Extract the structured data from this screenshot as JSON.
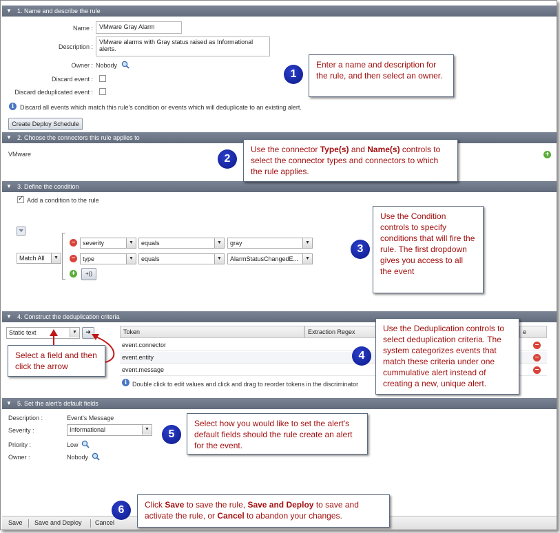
{
  "sections": {
    "s1": "1. Name and describe the rule",
    "s2": "2. Choose the connectors this rule applies to",
    "s3": "3. Define the condition",
    "s4": "4. Construct the deduplication criteria",
    "s5": "5. Set the alert's default fields"
  },
  "rule": {
    "name_label": "Name :",
    "name_value": "VMware Gray Alarm",
    "description_label": "Description :",
    "description_value": "VMware alarms with Gray status raised as Informational alerts.",
    "owner_label": "Owner :",
    "owner_value": "Nobody",
    "discard_label": "Discard event :",
    "discard_dedup_label": "Discard deduplicated event :",
    "info_text": "Discard all events which match this rule's condition or events which will deduplicate to an existing alert.",
    "schedule_button": "Create Deploy Schedule"
  },
  "connectors": {
    "item": "VMware"
  },
  "condition": {
    "add_label": "Add a condition to the rule",
    "match": "Match All",
    "rows": [
      {
        "field": "severity",
        "op": "equals",
        "value": "gray"
      },
      {
        "field": "type",
        "op": "equals",
        "value": "AlarmStatusChangedE..."
      }
    ],
    "group_button": "+()"
  },
  "dedup": {
    "selector": "Static text",
    "columns": {
      "token": "Token",
      "regex": "Extraction Regex",
      "e": "e"
    },
    "tokens": [
      "event.connector",
      "event.entity",
      "event.message"
    ],
    "hint": "Double click to edit values and click and drag to reorder tokens in the discriminator"
  },
  "defaults": {
    "description_label": "Description :",
    "description_value": "Event's Message",
    "severity_label": "Severity :",
    "severity_value": "Informational",
    "priority_label": "Priority :",
    "priority_value": "Low",
    "owner_label": "Owner :",
    "owner_value": "Nobody"
  },
  "footer": {
    "save": "Save",
    "save_deploy": "Save and Deploy",
    "cancel": "Cancel"
  },
  "callouts": {
    "c1": {
      "num": "1",
      "text": "Enter a name and description for the rule, and then select an owner."
    },
    "c2": {
      "num": "2",
      "a": "Use the connector ",
      "b1": "Type(s)",
      "c": " and ",
      "b2": "Name(s)",
      "d": " controls to select the connector types and connectors to which the rule applies."
    },
    "c3": {
      "num": "3",
      "text": "Use the Condition controls to specify conditions that will fire the rule. The first dropdown gives you access to all the event"
    },
    "c4": {
      "num": "4",
      "text": "Use the Deduplication controls to select deduplication criteria. The system categorizes events that match these criteria under one cummulative alert instead of creating a new, unique alert."
    },
    "c5": {
      "num": "5",
      "text": "Select how you would like to set the alert's default fields should the rule create an alert for the event."
    },
    "c6": {
      "num": "6",
      "a": "Click ",
      "b1": "Save",
      "c": " to save the rule, ",
      "b2": "Save and Deploy",
      "d": " to save and activate the rule, or ",
      "b3": "Cancel",
      "e": " to abandon your changes."
    },
    "arrow_note": "Select a field and then click the arrow"
  },
  "colors": {
    "header": "#6b7585",
    "callout_text": "#a31010",
    "badge": "#1a2aa8"
  }
}
